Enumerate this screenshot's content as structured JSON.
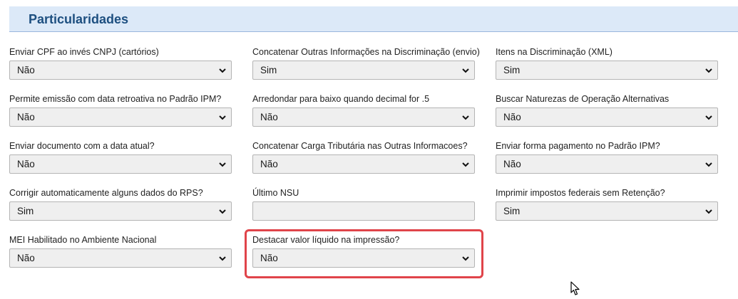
{
  "section": {
    "title": "Particularidades"
  },
  "fields": [
    {
      "label": "Enviar CPF ao invés CNPJ (cartórios)",
      "value": "Não"
    },
    {
      "label": "Concatenar Outras Informações na Discriminação (envio)",
      "value": "Sim"
    },
    {
      "label": "Itens na Discriminação (XML)",
      "value": "Sim"
    },
    {
      "label": "Permite emissão com data retroativa no Padrão IPM?",
      "value": "Não"
    },
    {
      "label": "Arredondar para baixo quando decimal for .5",
      "value": "Não"
    },
    {
      "label": "Buscar Naturezas de Operação Alternativas",
      "value": "Não"
    },
    {
      "label": "Enviar documento com a data atual?",
      "value": "Não"
    },
    {
      "label": "Concatenar Carga Tributária nas Outras Informacoes?",
      "value": "Não"
    },
    {
      "label": "Enviar forma pagamento no Padrão IPM?",
      "value": "Não"
    },
    {
      "label": "Corrigir automaticamente alguns dados do RPS?",
      "value": "Sim"
    },
    {
      "label": "Último NSU",
      "value": ""
    },
    {
      "label": "Imprimir impostos federais sem Retenção?",
      "value": "Sim"
    },
    {
      "label": "MEI Habilitado no Ambiente Nacional",
      "value": "Não"
    },
    {
      "label": "Destacar valor líquido na impressão?",
      "value": "Não"
    }
  ],
  "colors": {
    "header_background": "#dce9f8",
    "header_title": "#1d4f80",
    "field_background": "#efefef",
    "highlight_border": "#e0444a"
  },
  "icons": {
    "select_arrow": "chevron-down-icon",
    "cursor": "mouse-pointer-icon"
  }
}
